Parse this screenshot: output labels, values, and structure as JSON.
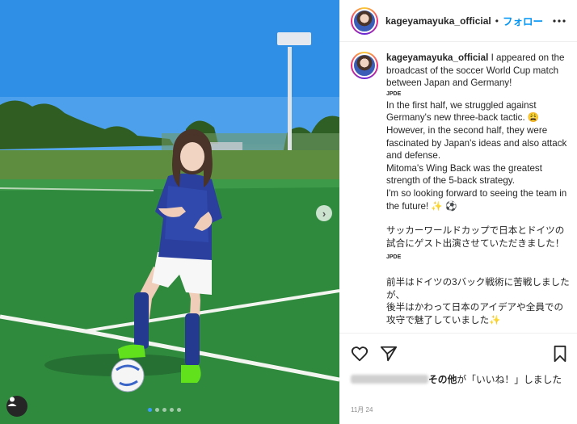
{
  "post": {
    "username": "kageyamayuka_official",
    "follow_label": "フォロー",
    "separator": "•",
    "caption": {
      "en_intro": "I appeared on the broadcast of the soccer World Cup match between Japan and Germany!",
      "tag_jpde": "JPDE",
      "en_line1": "In the first half, we struggled against Germany's new three-back tactic. 😩",
      "en_line2": "However, in the second half, they were fascinated by Japan's ideas and also attack and defense.",
      "en_line3": "Mitoma's Wing Back was the greatest strength of the 5-back strategy.",
      "en_line4": "I'm so looking forward to seeing the team in the future! ✨ ⚽",
      "jp_line1": "サッカーワールドカップで日本とドイツの試合にゲスト出演させていただきました！",
      "jp_line2": "前半はドイツの3バック戦術に苦戦しましたが、",
      "jp_line3": "後半はかわって日本のアイデアや全員での攻守で魅了していました✨"
    },
    "likes": {
      "suffix_bold": "その他",
      "suffix_text": "が「いいね！」しました"
    },
    "date": "11月 24"
  },
  "media": {
    "next_icon": "chevron-right-icon",
    "carousel_count": 5,
    "carousel_active": 0,
    "user_tag_icon": "user-icon"
  },
  "colors": {
    "follow": "#0095f6",
    "sky": "#2e8ee8",
    "grass": "#2f8f3f",
    "jersey": "#2b3f9e"
  },
  "icons": {
    "like": "heart-icon",
    "share": "send-icon",
    "save": "bookmark-icon",
    "options": "more-icon"
  }
}
